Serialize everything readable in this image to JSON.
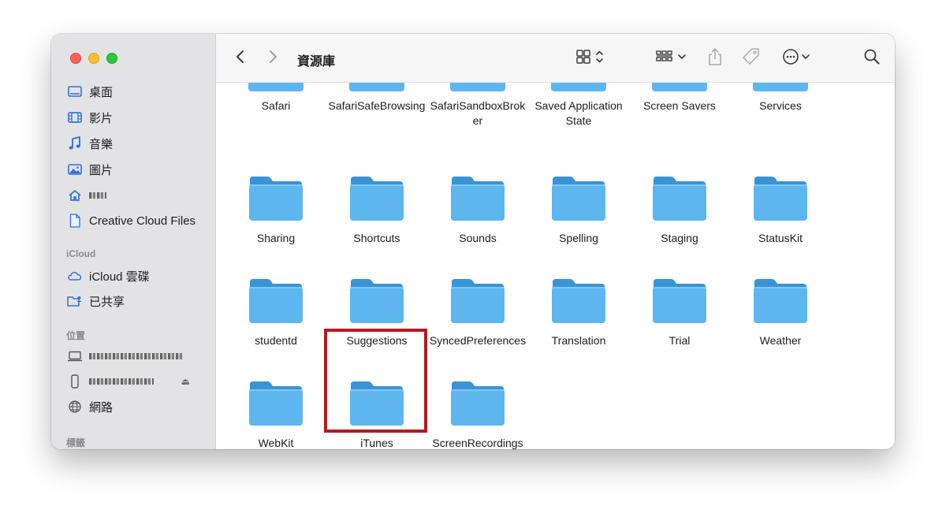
{
  "window": {
    "title": "資源庫"
  },
  "sidebar": {
    "favorites": [
      {
        "label": "桌面",
        "icon": "desktop-icon"
      },
      {
        "label": "影片",
        "icon": "film-icon"
      },
      {
        "label": "音樂",
        "icon": "music-note-icon"
      },
      {
        "label": "圖片",
        "icon": "photo-icon"
      },
      {
        "label": "",
        "icon": "home-icon"
      },
      {
        "label": "Creative Cloud Files",
        "icon": "document-icon"
      }
    ],
    "icloud_header": "iCloud",
    "icloud": [
      {
        "label": "iCloud 雲碟",
        "icon": "cloud-icon"
      },
      {
        "label": "已共享",
        "icon": "shared-folder-icon"
      }
    ],
    "locations_header": "位置",
    "locations": [
      {
        "label": "",
        "icon": "laptop-icon"
      },
      {
        "label": "",
        "icon": "phone-icon"
      },
      {
        "label": "網路",
        "icon": "globe-icon"
      }
    ],
    "tags_header": "標籤"
  },
  "toolbar": {
    "back_icon": "chevron-left-icon",
    "forward_icon": "chevron-right-icon",
    "view_icon": "grid-view-icon",
    "group_icon": "group-list-icon",
    "share_icon": "share-icon",
    "tag_icon": "tag-icon",
    "more_icon": "ellipsis-circle-icon",
    "search_icon": "search-icon"
  },
  "files": {
    "row0": [
      "Safari",
      "SafariSafeBrowsing",
      "SafariSandboxBroker",
      "Saved Application State",
      "Screen Savers",
      "Services"
    ],
    "row1": [
      "Sharing",
      "Shortcuts",
      "Sounds",
      "Spelling",
      "Staging",
      "StatusKit"
    ],
    "row2": [
      "studentd",
      "Suggestions",
      "SyncedPreferences",
      "Translation",
      "Trial",
      "Weather"
    ],
    "row3": [
      "WebKit",
      "iTunes",
      "ScreenRecordings"
    ]
  },
  "colors": {
    "folder_front": "#5eb6ef",
    "folder_back": "#3a93d6",
    "highlight": "#b31b22"
  }
}
